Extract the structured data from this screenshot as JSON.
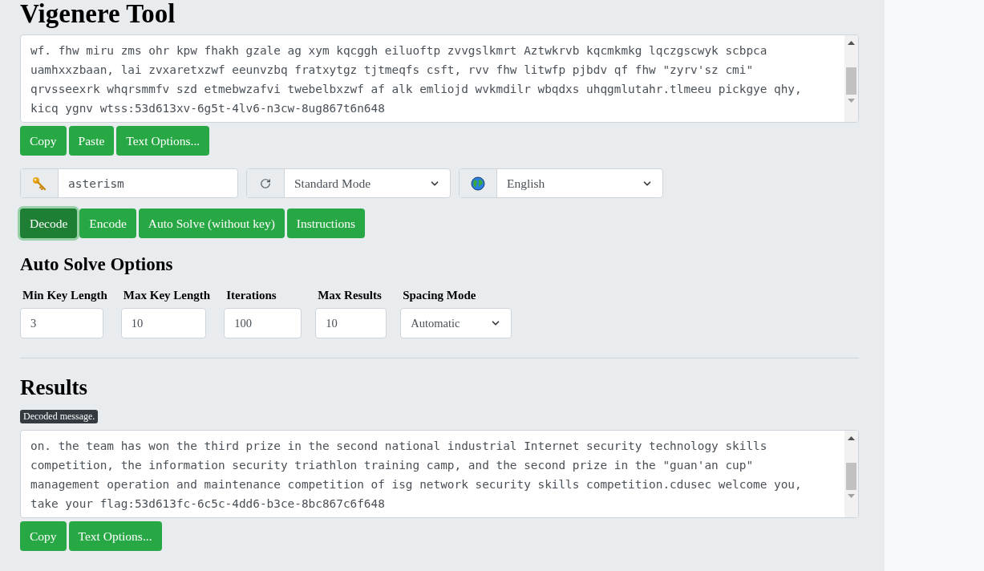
{
  "title": "Vigenere Tool",
  "input": {
    "lines": [
      "wf. fhw miru zms ohr kpw fhakh gzale ag xym kqcggh eiluoftp zvvgslkmrt Aztwkrvb kqcmkmkg lqczgscwyk scbpca",
      "uamhxxzbaan, lai zvxaretxzwf eeunvzbq fratxytgz tjtmeqfs csft, rvv fhw litwfp pjbdv qf fhw \"zyrv'sz cmi\"",
      "qrvsseexrk whqrsmmfv szd etmebwzafvi twebelbxzwf af alk emliojd wvkmdilr wbqdxs uhqgmlutahr.tlmeeu pickgye qhy,",
      "kicq ygnv wtss:53d613xv-6g5t-4lv6-n3cw-8ug867t6n648"
    ]
  },
  "input_actions": [
    "Copy",
    "Paste",
    "Text Options..."
  ],
  "key": {
    "value": "asterism"
  },
  "mode": {
    "value": "Standard Mode"
  },
  "language": {
    "value": "English"
  },
  "actions": [
    {
      "label": "Decode",
      "selected": true
    },
    {
      "label": "Encode",
      "selected": false
    },
    {
      "label": "Auto Solve (without key)",
      "selected": false
    },
    {
      "label": "Instructions",
      "selected": false
    }
  ],
  "auto_solve": {
    "heading": "Auto Solve Options",
    "fields": [
      {
        "label": "Min Key Length",
        "kind": "input",
        "value": "3"
      },
      {
        "label": "Max Key Length",
        "kind": "input",
        "value": "10"
      },
      {
        "label": "Iterations",
        "kind": "input",
        "value": "100"
      },
      {
        "label": "Max Results",
        "kind": "input",
        "value": "10"
      },
      {
        "label": "Spacing Mode",
        "kind": "select",
        "value": "Automatic"
      }
    ]
  },
  "results": {
    "heading": "Results",
    "badge": "Decoded message.",
    "lines": [
      "on. the team has won the third prize in the second national industrial Internet security technology skills",
      "competition, the information security triathlon training camp, and the second prize in the \"guan'an cup\"",
      "management operation and maintenance competition of isg network security skills competition.cdusec welcome you,",
      "take your flag:53d613fc-6c5c-4dd6-b3ce-8bc867c6f648"
    ],
    "actions": [
      "Copy",
      "Text Options..."
    ]
  }
}
